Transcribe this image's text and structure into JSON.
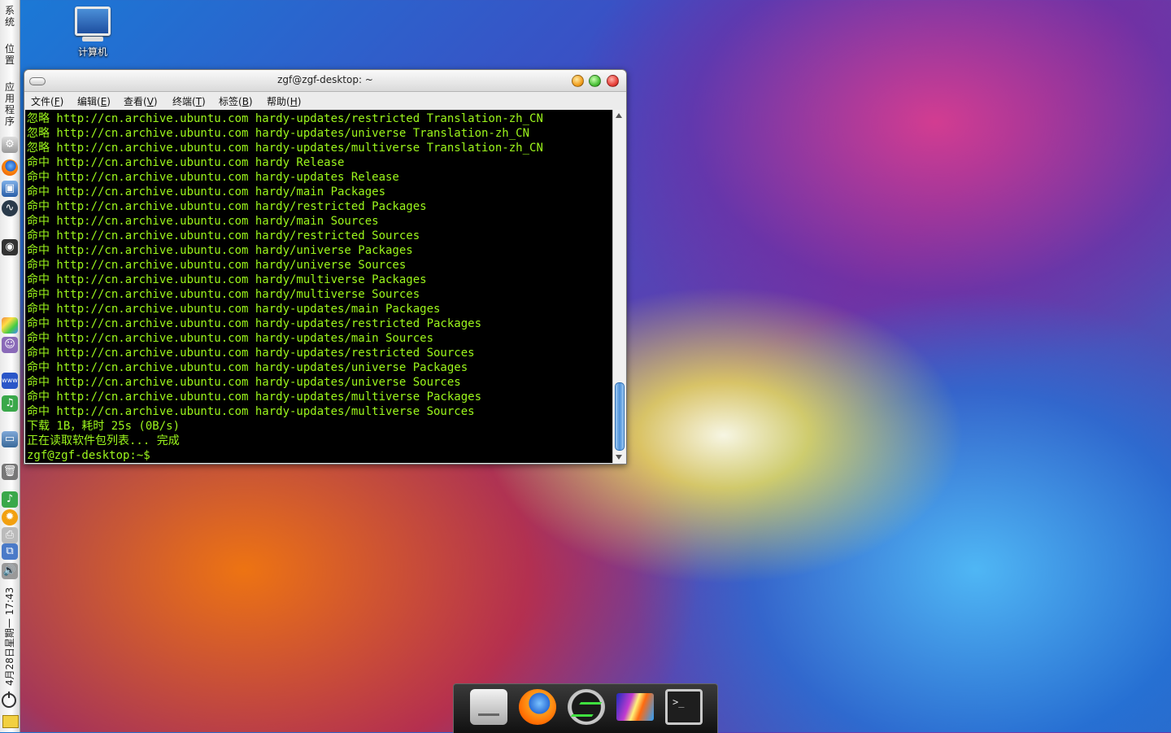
{
  "left_panel": {
    "menus": [
      {
        "label": "系统"
      },
      {
        "label": "位置"
      },
      {
        "label": "应用程序"
      }
    ],
    "clock": "4月28日星期一 17:43"
  },
  "desktop": {
    "icons": [
      {
        "label": "计算机",
        "icon": "computer-icon"
      }
    ]
  },
  "terminal": {
    "title": "zgf@zgf-desktop: ~",
    "menu": [
      {
        "label": "文件(",
        "key": "F",
        "end": ")"
      },
      {
        "label": "编辑(",
        "key": "E",
        "end": ")"
      },
      {
        "label": "查看(",
        "key": "V",
        "end": ")"
      },
      {
        "label": "终端(",
        "key": "T",
        "end": ")"
      },
      {
        "label": "标签(",
        "key": "B",
        "end": ")"
      },
      {
        "label": "帮助(",
        "key": "H",
        "end": ")"
      }
    ],
    "output": "忽略 http://cn.archive.ubuntu.com hardy-updates/restricted Translation-zh_CN\n忽略 http://cn.archive.ubuntu.com hardy-updates/universe Translation-zh_CN\n忽略 http://cn.archive.ubuntu.com hardy-updates/multiverse Translation-zh_CN\n命中 http://cn.archive.ubuntu.com hardy Release\n命中 http://cn.archive.ubuntu.com hardy-updates Release\n命中 http://cn.archive.ubuntu.com hardy/main Packages\n命中 http://cn.archive.ubuntu.com hardy/restricted Packages\n命中 http://cn.archive.ubuntu.com hardy/main Sources\n命中 http://cn.archive.ubuntu.com hardy/restricted Sources\n命中 http://cn.archive.ubuntu.com hardy/universe Packages\n命中 http://cn.archive.ubuntu.com hardy/universe Sources\n命中 http://cn.archive.ubuntu.com hardy/multiverse Packages\n命中 http://cn.archive.ubuntu.com hardy/multiverse Sources\n命中 http://cn.archive.ubuntu.com hardy-updates/main Packages\n命中 http://cn.archive.ubuntu.com hardy-updates/restricted Packages\n命中 http://cn.archive.ubuntu.com hardy-updates/main Sources\n命中 http://cn.archive.ubuntu.com hardy-updates/restricted Sources\n命中 http://cn.archive.ubuntu.com hardy-updates/universe Packages\n命中 http://cn.archive.ubuntu.com hardy-updates/universe Sources\n命中 http://cn.archive.ubuntu.com hardy-updates/multiverse Packages\n命中 http://cn.archive.ubuntu.com hardy-updates/multiverse Sources\n下载 1B，耗时 25s (0B/s)\n正在读取软件包列表... 完成\nzgf@zgf-desktop:~$",
    "text_color": "#9cf61c"
  },
  "dock": {
    "items": [
      {
        "icon": "drive-icon"
      },
      {
        "icon": "firefox-icon"
      },
      {
        "icon": "system-monitor-icon"
      },
      {
        "icon": "wallpaper-icon"
      },
      {
        "icon": "terminal-icon"
      }
    ]
  }
}
